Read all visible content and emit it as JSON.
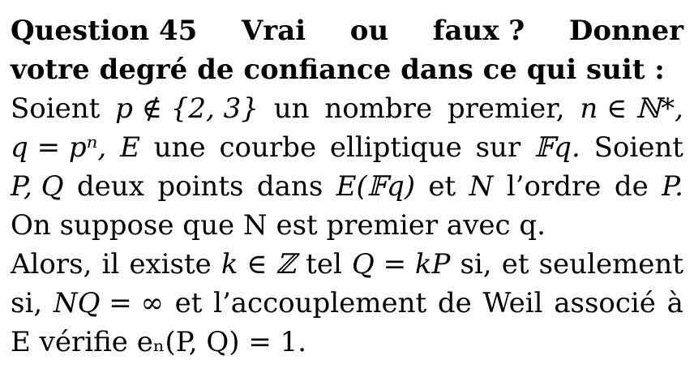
{
  "question": {
    "label": "Question 45",
    "heading_words": [
      "Vrai",
      "ou",
      "faux ?",
      "Donner"
    ],
    "heading_line2": "votre degré de confiance dans ce qui suit :"
  },
  "body": {
    "line1": [
      "Soient",
      "p ∉ {2, 3}",
      "un",
      "nombre",
      "premier,",
      "n ∈ ℕ*,"
    ],
    "line2": [
      "q = pⁿ,",
      "E",
      "une",
      "courbe",
      "elliptique",
      "sur",
      "𝔽q.",
      "Soient"
    ],
    "line3": [
      "P, Q",
      "deux",
      "points",
      "dans",
      "E(𝔽q)",
      "et",
      "N",
      "l’ordre",
      "de",
      "P."
    ],
    "line4": "On suppose que N est premier avec q.",
    "line5": [
      "Alors,",
      "il",
      "existe",
      "k ∈ ℤ",
      "tel",
      "Q = kP",
      "si,",
      "et",
      "seulement"
    ],
    "line6": [
      "si,",
      "NQ = ∞",
      "et",
      "l’accouplement",
      "de",
      "Weil",
      "associé",
      "à"
    ],
    "line7": "E vérifie eₙ(P, Q) = 1."
  }
}
